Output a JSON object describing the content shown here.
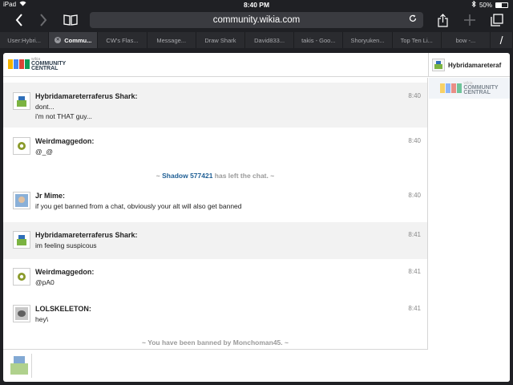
{
  "status": {
    "device": "iPad",
    "time": "8:40 PM",
    "battery": "50%"
  },
  "browser": {
    "url": "community.wikia.com",
    "tabs": [
      {
        "label": "User:Hybri..."
      },
      {
        "label": "Commu...",
        "active": true
      },
      {
        "label": "CW's Flas..."
      },
      {
        "label": "Message..."
      },
      {
        "label": "Draw Shark"
      },
      {
        "label": "David833..."
      },
      {
        "label": "takis - Goo..."
      },
      {
        "label": "Shoryuken..."
      },
      {
        "label": "Top Ten Li..."
      },
      {
        "label": "bow -..."
      }
    ]
  },
  "site": {
    "logo_small": "wikia",
    "logo_line1": "COMMUNITY",
    "logo_line2": "CENTRAL"
  },
  "header": {
    "current_user": "Hybridamareteraf"
  },
  "messages": [
    {
      "user": "Hybridamareterraferus Shark:",
      "time": "8:40",
      "lines": [
        "dont...",
        "i'm not THAT guy..."
      ]
    },
    {
      "user": "Weirdmaggedon:",
      "time": "8:40",
      "lines": [
        "@_@"
      ]
    },
    {
      "user": "Jr Mime:",
      "time": "8:40",
      "lines": [
        "if you get banned from a chat, obviously your alt will also get banned"
      ]
    },
    {
      "user": "Hybridamareterraferus Shark:",
      "time": "8:41",
      "lines": [
        "im feeling suspicous"
      ]
    },
    {
      "user": "Weirdmaggedon:",
      "time": "8:41",
      "lines": [
        "@pA0"
      ]
    },
    {
      "user": "LOLSKELETON:",
      "time": "8:41",
      "lines": [
        "hey\\"
      ]
    }
  ],
  "inline_events": {
    "left": {
      "prefix": "~ ",
      "who": "Shadow 577421",
      "suffix": " has left the chat. ~"
    },
    "banned": {
      "text": "~ You have been banned by Monchoman45. ~"
    }
  },
  "colors": {
    "accent_link": "#1f5f95",
    "alt_row": "#f2f2f2"
  }
}
